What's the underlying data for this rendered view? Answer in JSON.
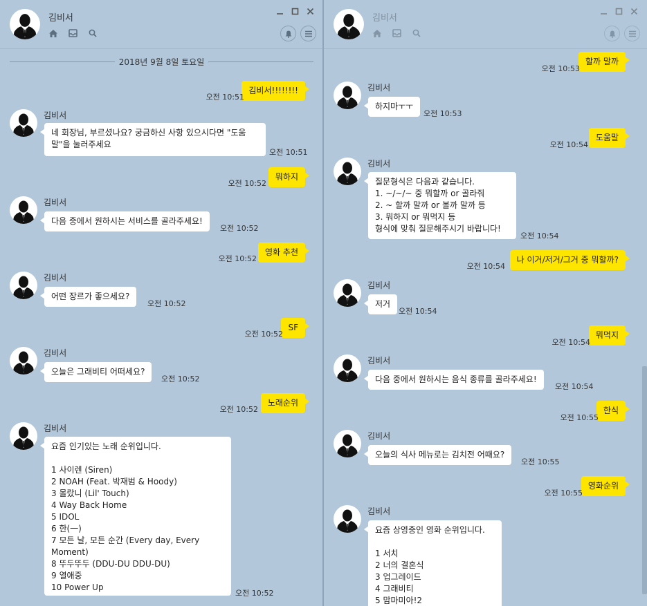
{
  "left": {
    "title": "김비서",
    "date_separator": "2018년 9월 8일 토요일",
    "messages": [
      {
        "text": "김비서!!!!!!!!",
        "time": "오전 10:51"
      },
      {
        "sender": "김비서",
        "text": "네 회장님, 부르셨나요? 궁금하신 사항 있으시다면 \"도움\n말\"을 눌러주세요",
        "time": "오전 10:51"
      },
      {
        "text": "뭐하지",
        "time": "오전 10:52"
      },
      {
        "sender": "김비서",
        "text": "다음 중에서 원하시는 서비스를 골라주세요!",
        "time": "오전 10:52"
      },
      {
        "text": "영화 추천",
        "time": "오전 10:52"
      },
      {
        "sender": "김비서",
        "text": "어떤 장르가 좋으세요?",
        "time": "오전 10:52"
      },
      {
        "text": "SF",
        "time": "오전 10:52"
      },
      {
        "sender": "김비서",
        "text": "오늘은 그래비티 어떠세요?",
        "time": "오전 10:52"
      },
      {
        "text": "노래순위",
        "time": "오전 10:52"
      },
      {
        "sender": "김비서",
        "text": "요즘 인기있는 노래 순위입니다.\n\n1 사이렌 (Siren)\n2 NOAH (Feat. 박재범 & Hoody)\n3 몰랐니 (Lil' Touch)\n4 Way Back Home\n5 IDOL\n6 한(一)\n7 모든 날, 모든 순간 (Every day, Every Moment)\n8 뚜두뚜두 (DDU-DU DDU-DU)\n9 열애중\n10 Power Up",
        "time": "오전 10:52"
      }
    ]
  },
  "right": {
    "title": "김비서",
    "messages": [
      {
        "text": "할까 말까",
        "time": "오전 10:53"
      },
      {
        "sender": "김비서",
        "text": "하지마ㅜㅜ",
        "time": "오전 10:53"
      },
      {
        "text": "도움말",
        "time": "오전 10:54"
      },
      {
        "sender": "김비서",
        "text": "질문형식은 다음과 같습니다.\n  1. ~/~/~ 중 뭐할까 or 골라줘\n  2. ~ 할까 말까 or 볼까 말까 등\n  3. 뭐하지 or 뭐먹지 등\n  형식에 맞춰 질문해주시기 바랍니다!",
        "time": "오전 10:54"
      },
      {
        "text": "나 이거/저거/그거 중 뭐할까?",
        "time": "오전 10:54"
      },
      {
        "sender": "김비서",
        "text": "저거",
        "time": "오전 10:54"
      },
      {
        "text": "뭐먹지",
        "time": "오전 10:54"
      },
      {
        "sender": "김비서",
        "text": "다음 중에서 원하시는 음식 종류를 골라주세요!",
        "time": "오전 10:54"
      },
      {
        "text": "한식",
        "time": "오전 10:55"
      },
      {
        "sender": "김비서",
        "text": "오늘의 식사 메뉴로는 김치전 어때요?",
        "time": "오전 10:55"
      },
      {
        "text": "영화순위",
        "time": "오전 10:55"
      },
      {
        "sender": "김비서",
        "text": "요즘 상영중인 영화 순위입니다.\n\n1 서치\n2 너의 결혼식\n3 업그레이드\n4 그래비티\n5 맘마미아!2",
        "time": ""
      }
    ]
  },
  "colors": {
    "background": "#b2c7da",
    "outgoing_bubble": "#fee500",
    "incoming_bubble": "#ffffff"
  },
  "icons": [
    "home-icon",
    "inbox-icon",
    "search-icon",
    "minimize-icon",
    "maximize-icon",
    "close-icon",
    "bell-icon",
    "menu-icon",
    "avatar-silhouette"
  ]
}
